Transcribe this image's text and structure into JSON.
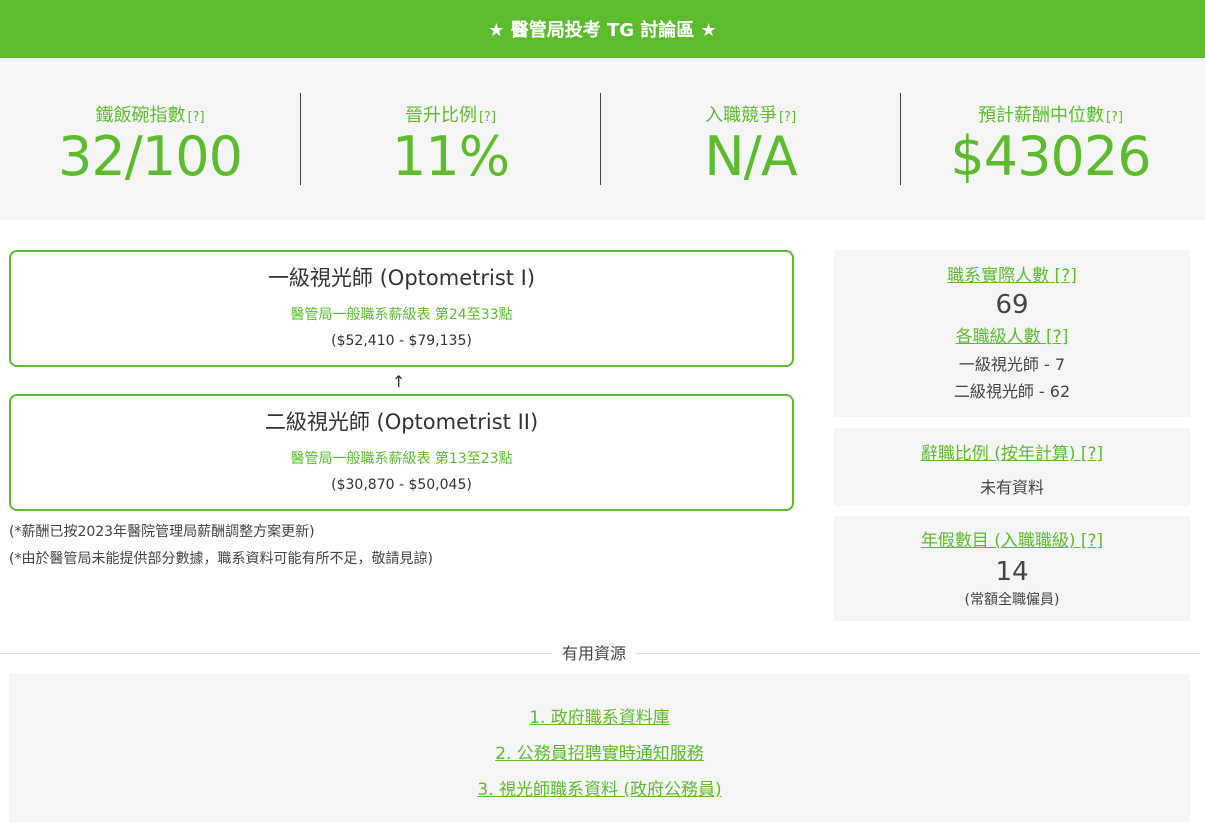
{
  "banner": {
    "title": "★ 醫管局投考 TG 討論區 ★"
  },
  "stats": [
    {
      "label": "鐵飯碗指數",
      "help": "[?]",
      "value": "32/100"
    },
    {
      "label": "晉升比例",
      "help": "[?]",
      "value": "11%"
    },
    {
      "label": "入職競爭",
      "help": "[?]",
      "value": "N/A"
    },
    {
      "label": "預計薪酬中位數",
      "help": "[?]",
      "value": "$43026"
    }
  ],
  "ranks": [
    {
      "title": "一級視光師 (Optometrist I)",
      "scale": "醫管局一般職系薪級表 第24至33點",
      "range": "($52,410 - $79,135)"
    },
    {
      "title": "二級視光師 (Optometrist II)",
      "scale": "醫管局一般職系薪級表 第13至23點",
      "range": "($30,870 - $50,045)"
    }
  ],
  "arrow": "↑",
  "notes": [
    "(*薪酬已按2023年醫院管理局薪酬調整方案更新)",
    "(*由於醫管局未能提供部分數據，職系資料可能有所不足，敬請見諒)"
  ],
  "side": {
    "headcount_link": "職系實際人數 [?]",
    "headcount_value": "69",
    "per_rank_link": "各職級人數 [?]",
    "per_rank": [
      "一級視光師 - 7",
      "二級視光師 - 62"
    ],
    "resign_link": "辭職比例 (按年計算) [?]",
    "resign_value": "未有資料",
    "leave_link": "年假數目 (入職職級) [?]",
    "leave_value": "14",
    "leave_note": "(常額全職僱員)"
  },
  "resources": {
    "heading": "有用資源",
    "links": [
      "1. 政府職系資料庫",
      "2. 公務員招聘實時通知服務",
      "3. 視光師職系資料 (政府公務員)"
    ]
  },
  "colors": {
    "accent": "#5cbc2e",
    "panel": "#f5f5f5"
  }
}
